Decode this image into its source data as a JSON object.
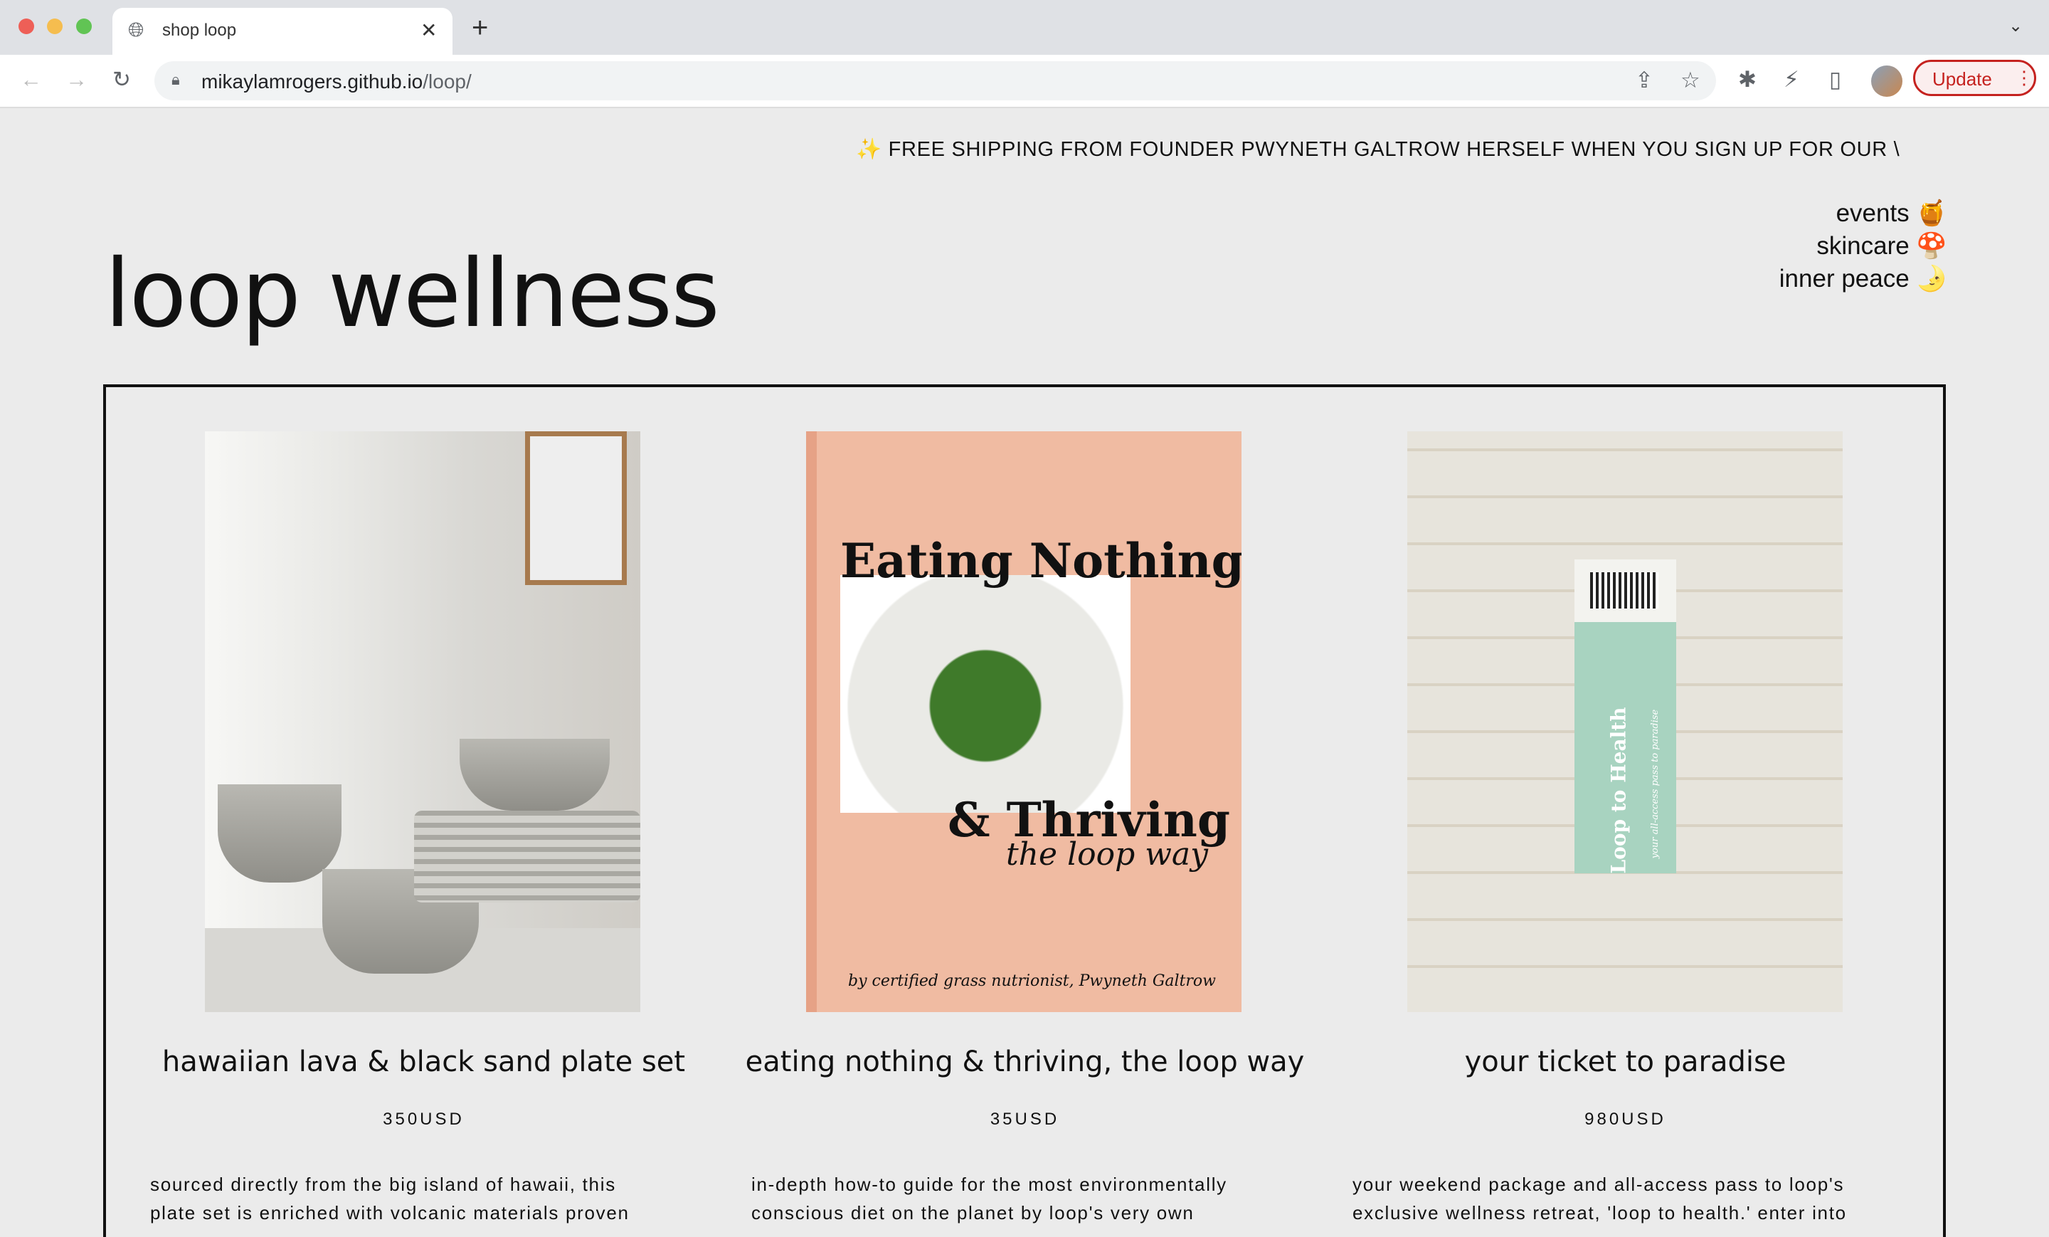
{
  "browser": {
    "tab_title": "shop loop",
    "url_host": "mikaylamrogers.github.io",
    "url_path": "/loop/",
    "update_label": "Update"
  },
  "ticker": "✨ FREE SHIPPING FROM FOUNDER PWYNETH GALTROW HERSELF WHEN YOU SIGN UP FOR OUR \\",
  "nav": [
    {
      "label": "events 🍯"
    },
    {
      "label": "skincare 🍄"
    },
    {
      "label": "inner peace 🌛"
    }
  ],
  "brand": "loop wellness",
  "products": [
    {
      "title": "hawaiian lava & black sand plate set",
      "price": "350USD",
      "desc1": "sourced directly from the big island of hawaii, this",
      "desc2": "plate set is enriched with volcanic materials proven"
    },
    {
      "title": "eating nothing & thriving, the loop way",
      "price": "35USD",
      "desc1": "in-depth how-to guide for the most environmentally",
      "desc2": "conscious diet on the planet by loop's very own",
      "cover": {
        "line1": "Eating Nothing",
        "line2": "& Thriving",
        "line3": "the loop way",
        "byline": "by certified grass nutrionist, Pwyneth Galtrow"
      }
    },
    {
      "title": "your ticket to paradise",
      "price": "980USD",
      "desc1": "your weekend package and all-access pass to loop's",
      "desc2": "exclusive wellness retreat, 'loop to health.' enter into",
      "ticket": {
        "title": "Loop to Health",
        "sub": "your all-access pass to paradise"
      }
    }
  ]
}
